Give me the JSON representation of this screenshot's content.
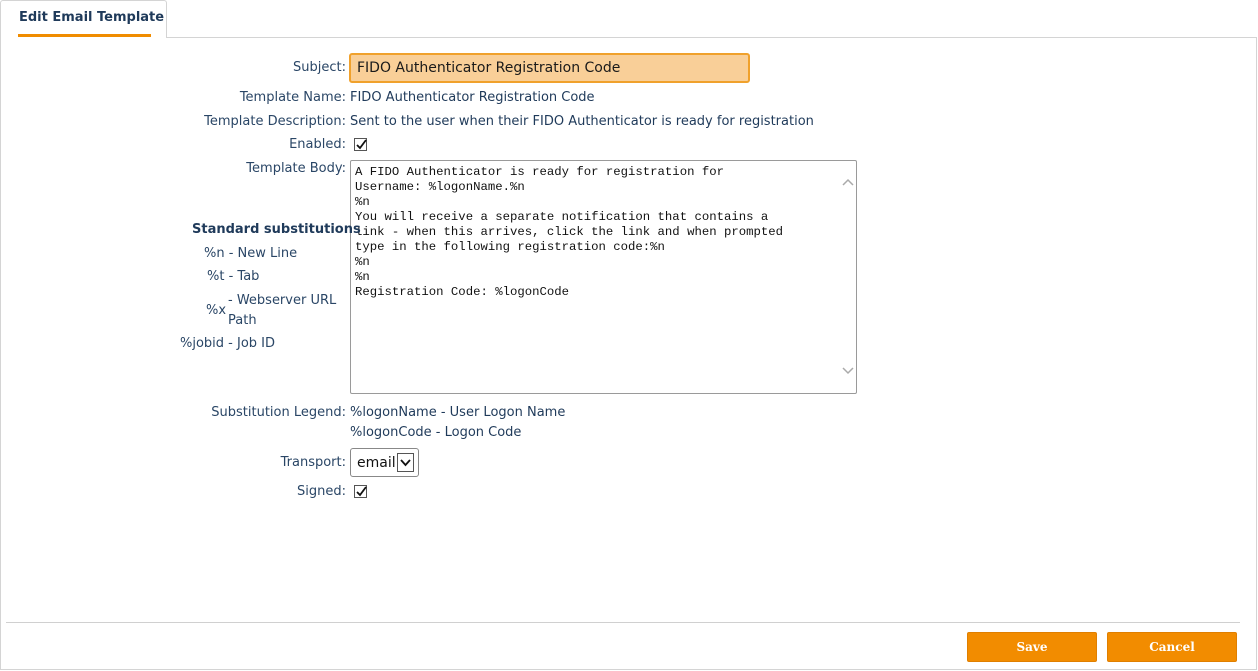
{
  "tab": {
    "label": "Edit Email Template"
  },
  "form": {
    "subject_label": "Subject:",
    "subject_value": "FIDO Authenticator Registration Code",
    "template_name_label": "Template Name:",
    "template_name_value": "FIDO Authenticator Registration Code",
    "template_description_label": "Template Description:",
    "template_description_value": "Sent to the user when their FIDO Authenticator is ready for registration",
    "enabled_label": "Enabled:",
    "enabled_checked": true,
    "template_body_label": "Template Body:",
    "template_body_value": "A FIDO Authenticator is ready for registration for\nUsername: %logonName.%n\n%n\nYou will receive a separate notification that contains a\nlink - when this arrives, click the link and when prompted\ntype in the following registration code:%n\n%n\n%n\nRegistration Code: %logonCode",
    "substitution_legend_label": "Substitution Legend:",
    "substitution_legend": [
      "%logonName - User Logon Name",
      "%logonCode - Logon Code"
    ],
    "transport_label": "Transport:",
    "transport_value": "email",
    "signed_label": "Signed:",
    "signed_checked": true
  },
  "standard_substitutions": {
    "title": "Standard substitutions",
    "newline": "%n - New Line",
    "tab": "%t - Tab",
    "webserver_code": "%x",
    "webserver_desc_1": "- Webserver URL",
    "webserver_desc_2": "Path",
    "jobid": "%jobid - Job ID"
  },
  "buttons": {
    "save": "Save",
    "cancel": "Cancel"
  },
  "colors": {
    "accent": "#f28c00",
    "subject_bg": "#f9cf98",
    "text": "#1f3a5a"
  }
}
